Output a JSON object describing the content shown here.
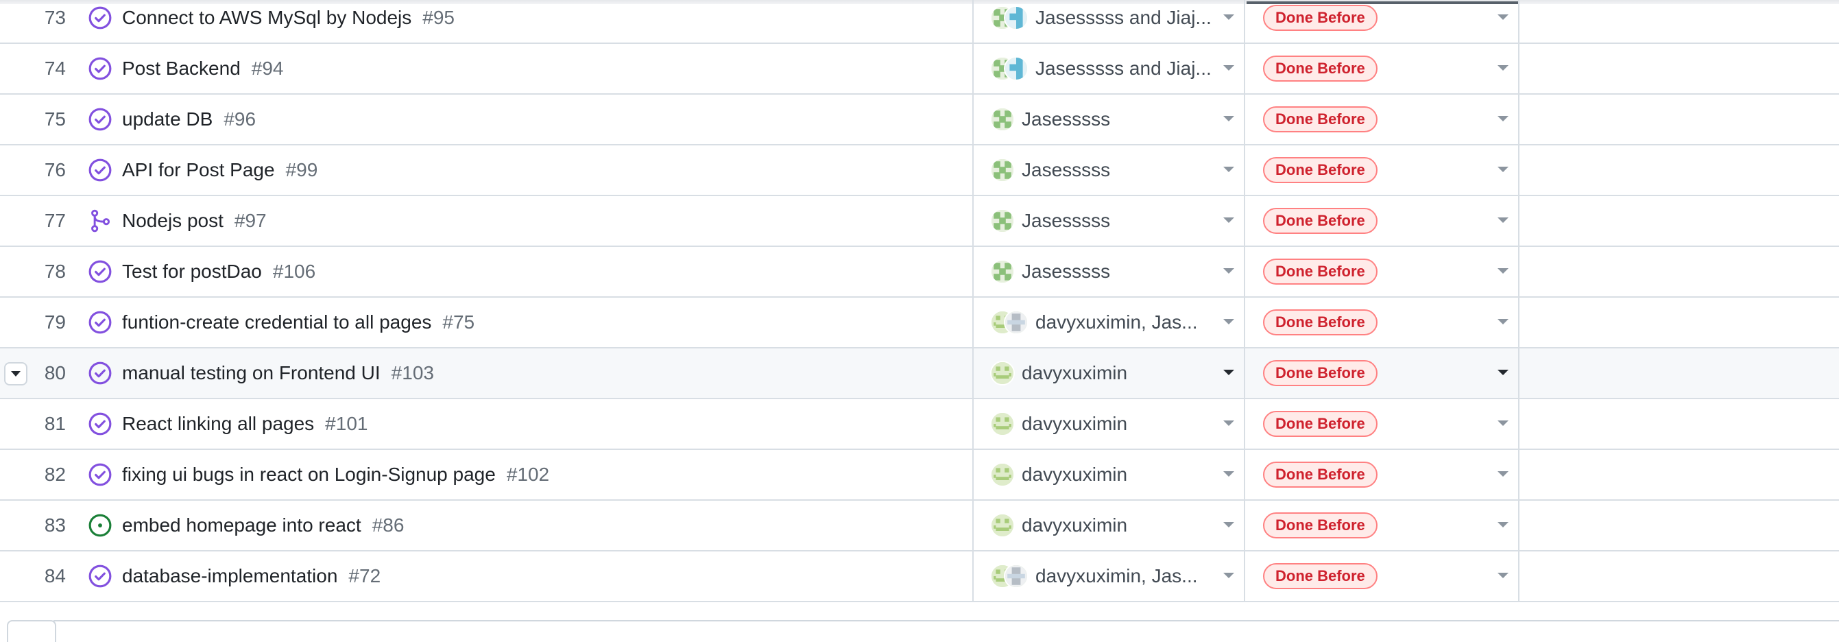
{
  "status_badge_colors": {
    "text": "#cf222e",
    "background": "#ffebe9",
    "border": "#ff8182"
  },
  "icon_colors": {
    "closed_issue": "#8250df",
    "merged_pr": "#8250df",
    "open_issue": "#1a7f37"
  },
  "rows": [
    {
      "num": "73",
      "icon": "closed-issue-icon",
      "title": "Connect to AWS MySql by Nodejs",
      "issue": "#95",
      "assignee": "Jasesssss and Jiaj...",
      "avatars": [
        "green-pattern",
        "blue-pattern"
      ],
      "status": "Done Before"
    },
    {
      "num": "74",
      "icon": "closed-issue-icon",
      "title": "Post Backend",
      "issue": "#94",
      "assignee": "Jasesssss and Jiaj...",
      "avatars": [
        "green-pattern",
        "blue-pattern"
      ],
      "status": "Done Before"
    },
    {
      "num": "75",
      "icon": "closed-issue-icon",
      "title": "update DB",
      "issue": "#96",
      "assignee": "Jasesssss",
      "avatars": [
        "green-pattern"
      ],
      "status": "Done Before"
    },
    {
      "num": "76",
      "icon": "closed-issue-icon",
      "title": "API for Post Page",
      "issue": "#99",
      "assignee": "Jasesssss",
      "avatars": [
        "green-pattern"
      ],
      "status": "Done Before"
    },
    {
      "num": "77",
      "icon": "merged-pr-icon",
      "title": "Nodejs post",
      "issue": "#97",
      "assignee": "Jasesssss",
      "avatars": [
        "green-pattern"
      ],
      "status": "Done Before"
    },
    {
      "num": "78",
      "icon": "closed-issue-icon",
      "title": "Test for postDao",
      "issue": "#106",
      "assignee": "Jasesssss",
      "avatars": [
        "green-pattern"
      ],
      "status": "Done Before"
    },
    {
      "num": "79",
      "icon": "closed-issue-icon",
      "title": "funtion-create credential to all pages",
      "issue": "#75",
      "assignee": "davyxuximin, Jas...",
      "avatars": [
        "lime-face",
        "grey-pattern"
      ],
      "status": "Done Before"
    },
    {
      "num": "80",
      "icon": "closed-issue-icon",
      "title": "manual testing on Frontend UI",
      "issue": "#103",
      "assignee": "davyxuximin",
      "avatars": [
        "lime-face"
      ],
      "status": "Done Before",
      "hovered": true
    },
    {
      "num": "81",
      "icon": "closed-issue-icon",
      "title": "React linking all pages",
      "issue": "#101",
      "assignee": "davyxuximin",
      "avatars": [
        "lime-face"
      ],
      "status": "Done Before"
    },
    {
      "num": "82",
      "icon": "closed-issue-icon",
      "title": "fixing ui bugs in react on Login-Signup page",
      "issue": "#102",
      "assignee": "davyxuximin",
      "avatars": [
        "lime-face"
      ],
      "status": "Done Before"
    },
    {
      "num": "83",
      "icon": "open-issue-icon",
      "title": "embed homepage into react",
      "issue": "#86",
      "assignee": "davyxuximin",
      "avatars": [
        "lime-face"
      ],
      "status": "Done Before"
    },
    {
      "num": "84",
      "icon": "closed-issue-icon",
      "title": "database-implementation",
      "issue": "#72",
      "assignee": "davyxuximin, Jas...",
      "avatars": [
        "lime-face",
        "grey-pattern"
      ],
      "status": "Done Before"
    }
  ]
}
